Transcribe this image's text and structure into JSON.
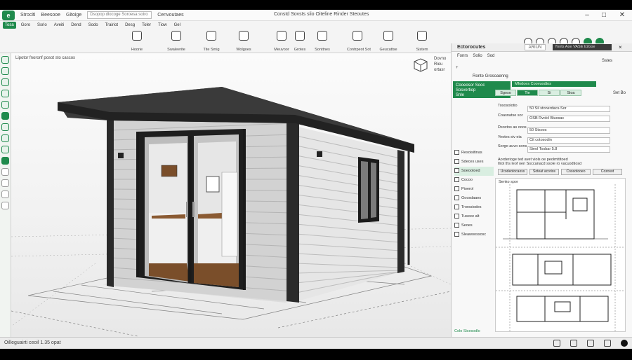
{
  "titlebar": {
    "logo": "e",
    "menus": [
      "Strociti",
      "Beesooe",
      "Gitoige"
    ],
    "search_text": "Dsopop dlocoge Soroesa sotro",
    "doc_tab": "Cenvoutaes",
    "window_title": "Constd Sovsts slio Oiteline Rinder Steoutes"
  },
  "ribbon": {
    "tabs": [
      "Tosa",
      "Goro",
      "Ssrio",
      "Aveiti",
      "Dend",
      "Sodo",
      "Trairiot",
      "Desg",
      "Toler",
      "Tiow",
      "Gel"
    ],
    "tools": [
      {
        "label": "Hoorie",
        "icon": "box-icon"
      },
      {
        "label": "Swaleerite",
        "icon": "wall-icon"
      },
      {
        "label": "Tite Smig",
        "icon": "tile-icon"
      },
      {
        "label": "Wolgoes",
        "icon": "window-icon"
      },
      {
        "label": "Meuvoor",
        "icon": "measure-icon"
      },
      {
        "label": "Grotes",
        "icon": "group-icon"
      },
      {
        "label": "Sonttnes",
        "icon": "settings-icon"
      },
      {
        "label": "Contrpeot Sot",
        "icon": "component-icon"
      },
      {
        "label": "Geucattse",
        "icon": "gear-icon"
      },
      {
        "label": "Sistem",
        "icon": "system-icon"
      }
    ]
  },
  "viewport": {
    "info_line": "Lipotor fnoronf posot sto cascos",
    "tool_hint": "Dovno Rieu ortasr"
  },
  "panel": {
    "title": "Ectorocutes",
    "search": "ARIUN",
    "dark_field": "Yonts Aoe VASE tr2ooe",
    "tabs": [
      "Fonrs",
      "Solio",
      "Sod"
    ],
    "rows_top": [
      "+",
      "Ronte Grosoaenng"
    ],
    "green_header_line1": "Cooeosor Sooc",
    "green_header_line2": "Sosvertiop",
    "green_header_line3": "Snle",
    "green_bar": "Mfodoes Coovuodtos",
    "sub_tabs": [
      "Sgoso",
      "Tie",
      "Si",
      "Sioa"
    ],
    "props": [
      {
        "k": "Tososolotio",
        "v": "50 Sil stonerdacs-Sor"
      },
      {
        "k": "Coasnatse sor",
        "v": "OSB Rvolcl Biuosac"
      },
      {
        "k": "Dsoctos as ooos",
        "v": "50 Stsoos"
      },
      {
        "k": "Yeotes siv eia",
        "v": "Cit cotosodin"
      },
      {
        "k": "Sorgo auvo sons",
        "v": "Sieol Tosbar 5.8"
      }
    ],
    "side_list": [
      "Resoisitinas",
      "Sdeces uses",
      "Soeootoed",
      "Cocoo",
      "Pioerol",
      "Goosdaaes",
      "Trorssiodes",
      "Tuseee alt",
      "Seoes",
      "Sleawoossosc"
    ],
    "section_header": "Aorderioge ted avet viols oe peolmttitoed",
    "section_sub": "Ilrot ths leof oen Ssccanacd ssole ro vacuodtiosd",
    "section_btns": [
      "Ucodeotocaoss",
      "Soteat acorios",
      "Coosotooeo",
      "Cozosot"
    ],
    "plans_label": "Senko spor",
    "footer": "Colo  Sicesodlo",
    "right_vals": [
      "Set Bo",
      "Sstes"
    ]
  },
  "statusbar": {
    "text": "Oilleguairti ceoil    1.35 opat"
  }
}
